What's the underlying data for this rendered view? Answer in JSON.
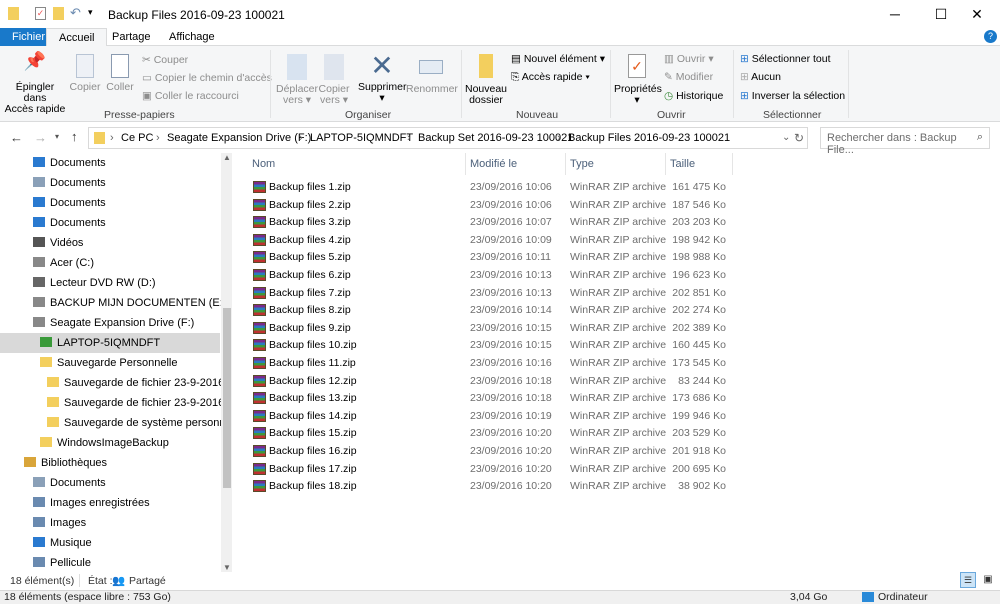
{
  "window": {
    "title": "Backup Files 2016-09-23 100021",
    "minimize": "─",
    "maximize": "☐",
    "close": "✕"
  },
  "tabs": [
    {
      "label": "Fichier"
    },
    {
      "label": "Accueil"
    },
    {
      "label": "Partage"
    },
    {
      "label": "Affichage"
    }
  ],
  "ribbon": {
    "clipboard": {
      "pin": "Épingler dans",
      "pin2": "Accès rapide",
      "copy": "Copier",
      "paste": "Coller",
      "cut": "Couper",
      "copy_path": "Copier le chemin d'accès",
      "paste_shortcut": "Coller le raccourci",
      "group": "Presse-papiers"
    },
    "organize": {
      "move": "Déplacer",
      "move2": "vers ▾",
      "copyto": "Copier",
      "copyto2": "vers ▾",
      "delete": "Supprimer",
      "delete2": "▾",
      "rename": "Renommer",
      "group": "Organiser"
    },
    "new": {
      "folder": "Nouveau",
      "folder2": "dossier",
      "new_item": "Nouvel élément ▾",
      "quick_access": "Accès rapide ▾",
      "group": "Nouveau"
    },
    "open": {
      "properties": "Propriétés",
      "properties2": "▾",
      "open": "Ouvrir ▾",
      "edit": "Modifier",
      "history": "Historique",
      "group": "Ouvrir"
    },
    "select": {
      "all": "Sélectionner tout",
      "none": "Aucun",
      "invert": "Inverser la sélection",
      "group": "Sélectionner"
    }
  },
  "address": {
    "crumbs": [
      "Ce PC",
      "Seagate Expansion Drive (F:)",
      "LAPTOP-5IQMNDFT",
      "Backup Set 2016-09-23 100021",
      "Backup Files 2016-09-23 100021"
    ],
    "search_placeholder": "Rechercher dans : Backup File..."
  },
  "nav": [
    {
      "label": "Documents",
      "icon": "desktop",
      "indent": 0
    },
    {
      "label": "Documents",
      "icon": "document",
      "indent": 0
    },
    {
      "label": "Documents",
      "icon": "music",
      "indent": 0
    },
    {
      "label": "Documents",
      "icon": "desktop",
      "indent": 0
    },
    {
      "label": "Vidéos",
      "icon": "video",
      "indent": 0
    },
    {
      "label": "Acer (C:)",
      "icon": "drive",
      "indent": 0
    },
    {
      "label": "Lecteur DVD RW (D:)",
      "icon": "dvd",
      "indent": 0
    },
    {
      "label": "BACKUP MIJN DOCUMENTEN (E:)",
      "icon": "drive",
      "indent": 0
    },
    {
      "label": "Seagate Expansion Drive (F:)",
      "icon": "drive",
      "indent": 0
    },
    {
      "label": "LAPTOP-5IQMNDFT",
      "icon": "backup",
      "indent": 1,
      "selected": true
    },
    {
      "label": "Sauvegarde Personnelle",
      "icon": "folder",
      "indent": 1
    },
    {
      "label": "Sauvegarde de fichier 23-9-2016",
      "icon": "folder",
      "indent": 2
    },
    {
      "label": "Sauvegarde de fichier 23-9-2016  11",
      "icon": "folder",
      "indent": 2
    },
    {
      "label": "Sauvegarde de système personnelle",
      "icon": "folder",
      "indent": 2
    },
    {
      "label": "WindowsImageBackup",
      "icon": "folder",
      "indent": 1
    },
    {
      "label": "Bibliothèques",
      "icon": "library",
      "indent": -1
    },
    {
      "label": "Documents",
      "icon": "document",
      "indent": 0
    },
    {
      "label": "Images enregistrées",
      "icon": "picture",
      "indent": 0
    },
    {
      "label": "Images",
      "icon": "picture",
      "indent": 0
    },
    {
      "label": "Musique",
      "icon": "music",
      "indent": 0
    },
    {
      "label": "Pellicule",
      "icon": "picture",
      "indent": 0
    }
  ],
  "columns": {
    "name": "Nom",
    "modified": "Modifié le",
    "type": "Type",
    "size": "Taille"
  },
  "files": [
    {
      "name": "Backup files 1.zip",
      "date": "23/09/2016 10:06",
      "type": "WinRAR ZIP archive",
      "size": "161 475 Ko"
    },
    {
      "name": "Backup files 2.zip",
      "date": "23/09/2016 10:06",
      "type": "WinRAR ZIP archive",
      "size": "187 546 Ko"
    },
    {
      "name": "Backup files 3.zip",
      "date": "23/09/2016 10:07",
      "type": "WinRAR ZIP archive",
      "size": "203 203 Ko"
    },
    {
      "name": "Backup files 4.zip",
      "date": "23/09/2016 10:09",
      "type": "WinRAR ZIP archive",
      "size": "198 942 Ko"
    },
    {
      "name": "Backup files 5.zip",
      "date": "23/09/2016 10:11",
      "type": "WinRAR ZIP archive",
      "size": "198 988 Ko"
    },
    {
      "name": "Backup files 6.zip",
      "date": "23/09/2016 10:13",
      "type": "WinRAR ZIP archive",
      "size": "196 623 Ko"
    },
    {
      "name": "Backup files 7.zip",
      "date": "23/09/2016 10:13",
      "type": "WinRAR ZIP archive",
      "size": "202 851 Ko"
    },
    {
      "name": "Backup files 8.zip",
      "date": "23/09/2016 10:14",
      "type": "WinRAR ZIP archive",
      "size": "202 274 Ko"
    },
    {
      "name": "Backup files 9.zip",
      "date": "23/09/2016 10:15",
      "type": "WinRAR ZIP archive",
      "size": "202 389 Ko"
    },
    {
      "name": "Backup files 10.zip",
      "date": "23/09/2016 10:15",
      "type": "WinRAR ZIP archive",
      "size": "160 445 Ko"
    },
    {
      "name": "Backup files 11.zip",
      "date": "23/09/2016 10:16",
      "type": "WinRAR ZIP archive",
      "size": "173 545 Ko"
    },
    {
      "name": "Backup files 12.zip",
      "date": "23/09/2016 10:18",
      "type": "WinRAR ZIP archive",
      "size": "83 244 Ko"
    },
    {
      "name": "Backup files 13.zip",
      "date": "23/09/2016 10:18",
      "type": "WinRAR ZIP archive",
      "size": "173 686 Ko"
    },
    {
      "name": "Backup files 14.zip",
      "date": "23/09/2016 10:19",
      "type": "WinRAR ZIP archive",
      "size": "199 946 Ko"
    },
    {
      "name": "Backup files 15.zip",
      "date": "23/09/2016 10:20",
      "type": "WinRAR ZIP archive",
      "size": "203 529 Ko"
    },
    {
      "name": "Backup files 16.zip",
      "date": "23/09/2016 10:20",
      "type": "WinRAR ZIP archive",
      "size": "201 918 Ko"
    },
    {
      "name": "Backup files 17.zip",
      "date": "23/09/2016 10:20",
      "type": "WinRAR ZIP archive",
      "size": "200 695 Ko"
    },
    {
      "name": "Backup files 18.zip",
      "date": "23/09/2016 10:20",
      "type": "WinRAR ZIP archive",
      "size": "38 902 Ko"
    }
  ],
  "status": {
    "count": "18 élément(s)",
    "state_label": "État :",
    "state": "Partagé"
  },
  "bottom": {
    "summary": "18 éléments (espace libre : 753 Go)",
    "size": "3,04 Go",
    "location": "Ordinateur"
  },
  "colors": {
    "accent": "#1979ca",
    "folder": "#f3cf5e",
    "selected": "#d9d9d9"
  }
}
